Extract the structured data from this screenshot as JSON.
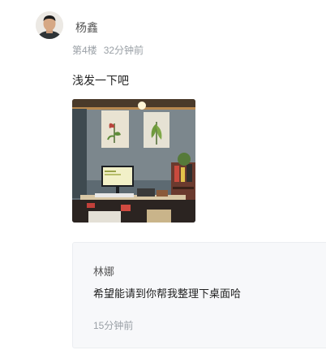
{
  "comment": {
    "username": "杨鑫",
    "floor": "第4楼",
    "time": "32分钟前",
    "text": "浅发一下吧",
    "avatar_icon": "user-avatar",
    "photo_icon": "desk-photo"
  },
  "reply": {
    "username": "林娜",
    "text": "希望能请到你帮我整理下桌面哈",
    "time": "15分钟前"
  },
  "colors": {
    "meta_gray": "#9aa0a6",
    "reply_bg": "#f7f8fa"
  }
}
